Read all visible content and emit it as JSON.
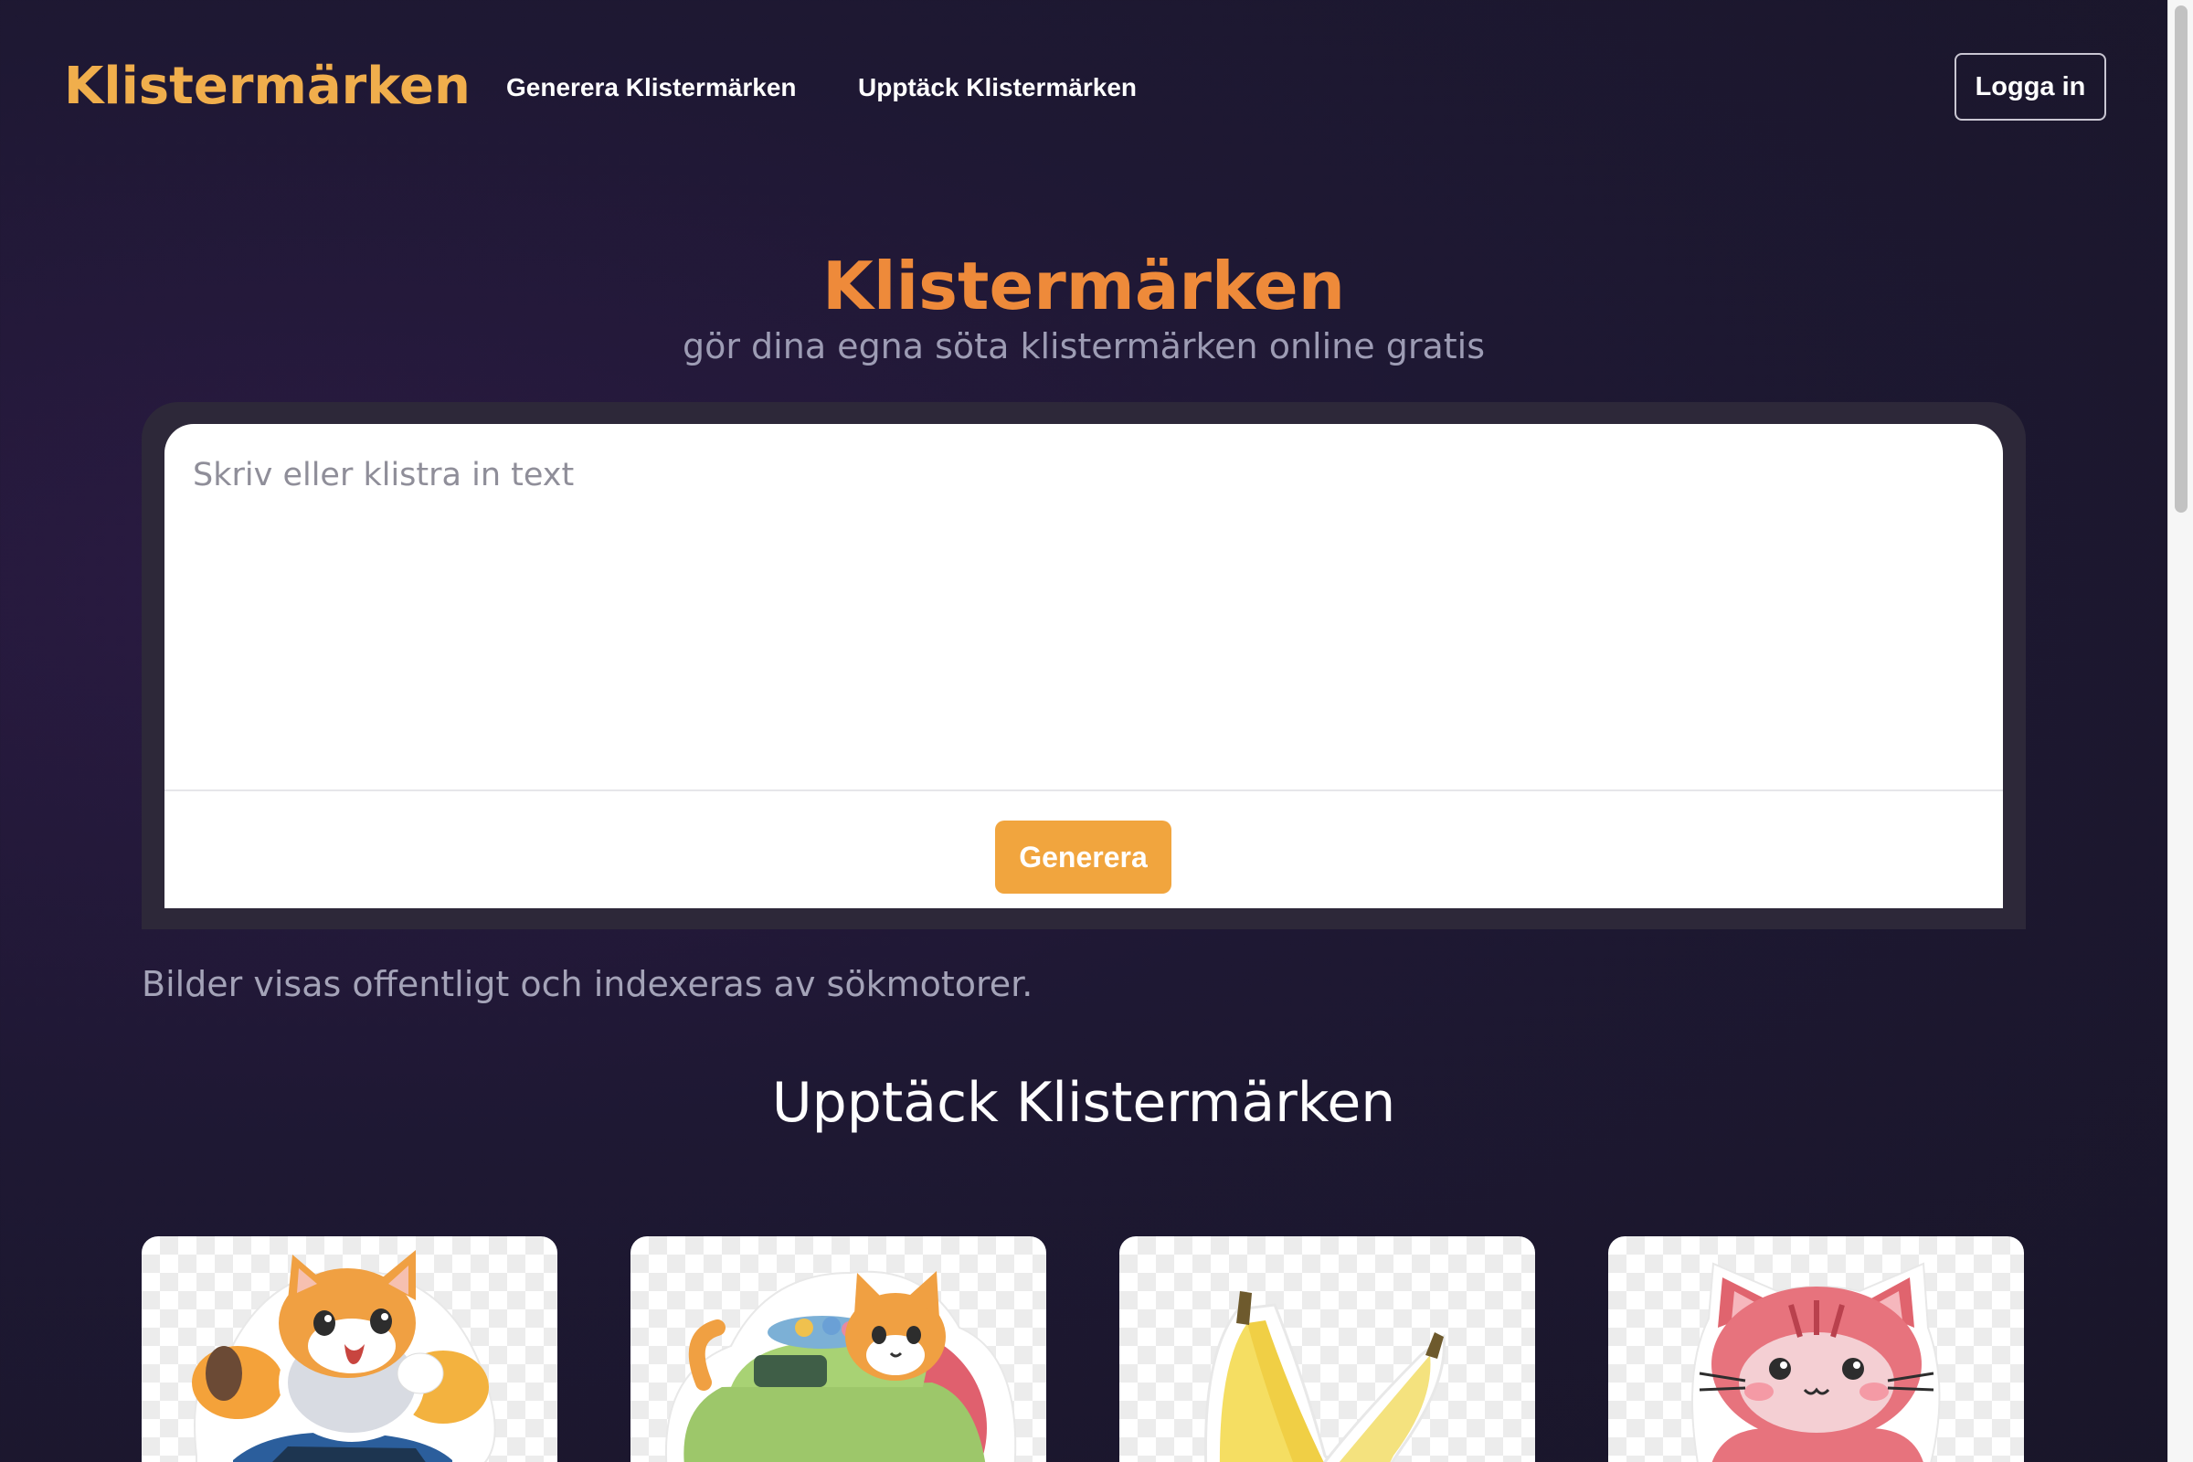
{
  "header": {
    "logo": "Klistermärken",
    "nav": [
      {
        "label": "Generera Klistermärken"
      },
      {
        "label": "Upptäck Klistermärken"
      }
    ],
    "login_label": "Logga in"
  },
  "hero": {
    "title": "Klistermärken",
    "subtitle": "gör dina egna söta klistermärken online gratis"
  },
  "generator": {
    "placeholder": "Skriv eller klistra in text",
    "value": "",
    "button_label": "Generera"
  },
  "notice": "Bilder visas offentligt och indexeras av sökmotorer.",
  "discover": {
    "title": "Upptäck Klistermärken",
    "stickers": [
      {
        "subject": "cat-on-car-sticker"
      },
      {
        "subject": "cat-in-green-car-sticker"
      },
      {
        "subject": "bananas-sticker"
      },
      {
        "subject": "pink-cat-sticker"
      }
    ]
  },
  "colors": {
    "brand": "#f0ae4c",
    "hero_title": "#ee8a3a",
    "button": "#f1a53e",
    "background": "#1e1833"
  }
}
